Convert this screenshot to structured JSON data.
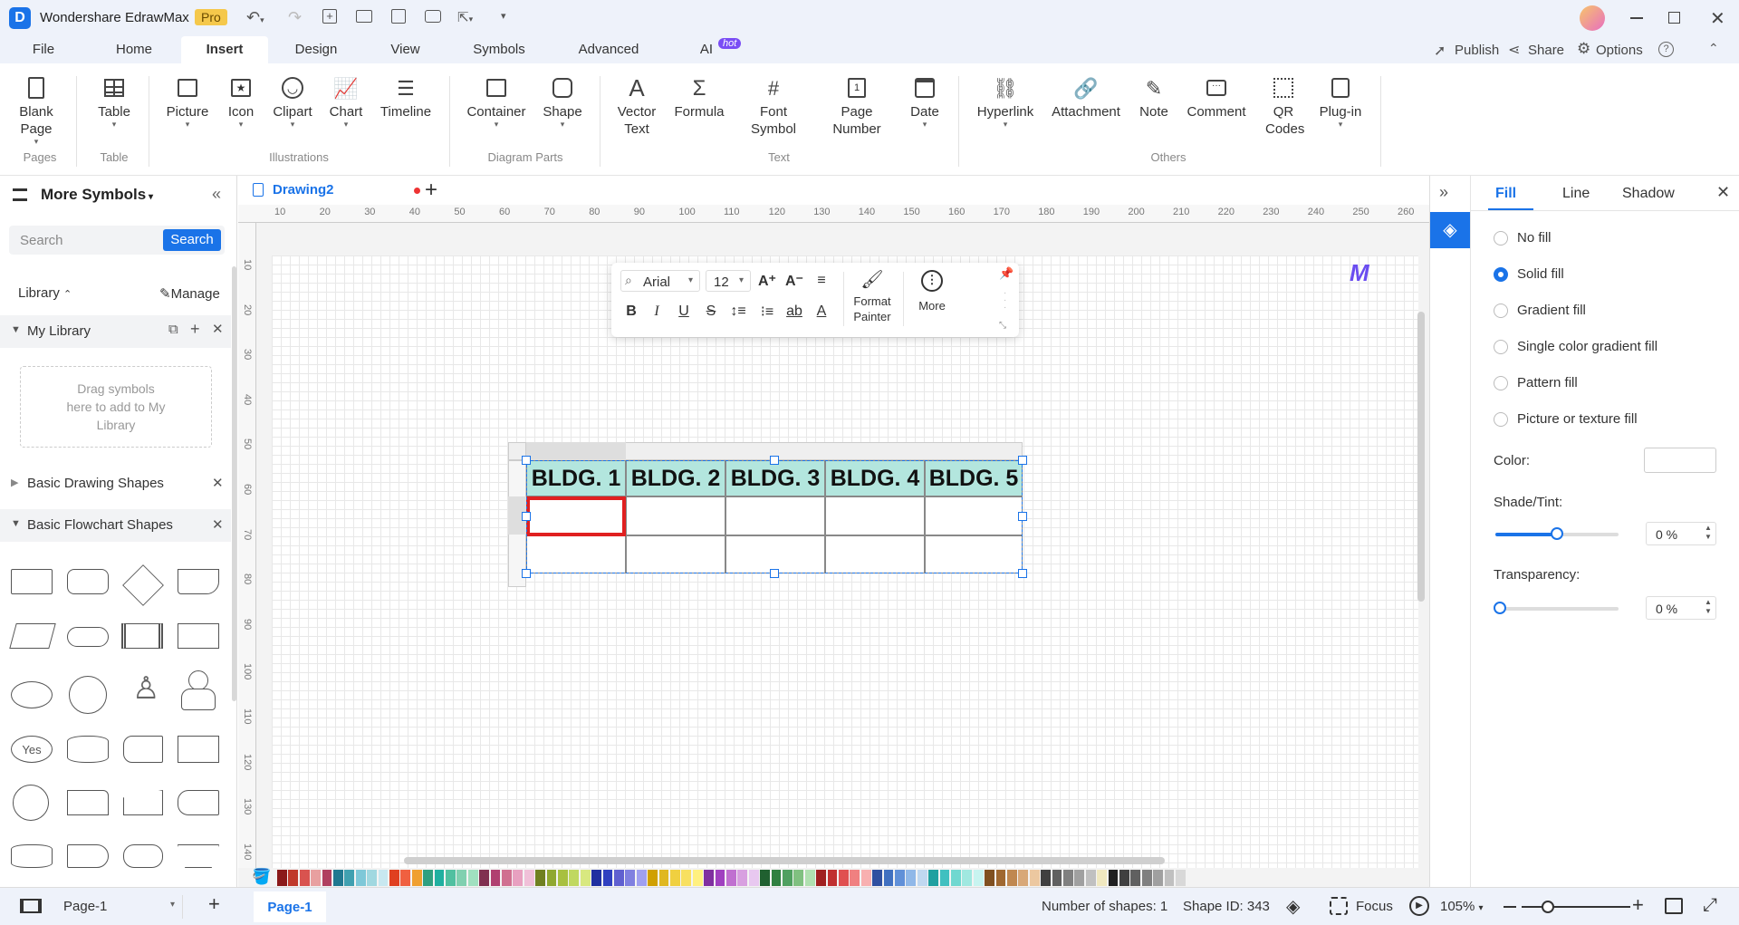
{
  "app": {
    "title": "Wondershare EdrawMax",
    "badge": "Pro"
  },
  "menu": {
    "tabs": [
      "File",
      "Home",
      "Insert",
      "Design",
      "View",
      "Symbols",
      "Advanced",
      "AI"
    ],
    "ai_badge": "hot",
    "active": "Insert",
    "right": {
      "publish": "Publish",
      "share": "Share",
      "options": "Options"
    }
  },
  "ribbon": {
    "buttons": [
      {
        "label": "Blank Page",
        "icon": "blank-page-icon"
      },
      {
        "label": "Table",
        "icon": "table-icon"
      },
      {
        "label": "Picture",
        "icon": "picture-icon"
      },
      {
        "label": "Icon",
        "icon": "icon-icon"
      },
      {
        "label": "Clipart",
        "icon": "clipart-icon"
      },
      {
        "label": "Chart",
        "icon": "chart-icon"
      },
      {
        "label": "Timeline",
        "icon": "timeline-icon"
      },
      {
        "label": "Container",
        "icon": "container-icon"
      },
      {
        "label": "Shape",
        "icon": "shape-icon"
      },
      {
        "label": "Vector Text",
        "icon": "vector-text-icon"
      },
      {
        "label": "Formula",
        "icon": "formula-icon"
      },
      {
        "label": "Font Symbol",
        "icon": "font-symbol-icon"
      },
      {
        "label": "Page Number",
        "icon": "page-number-icon"
      },
      {
        "label": "Date",
        "icon": "date-icon"
      },
      {
        "label": "Hyperlink",
        "icon": "hyperlink-icon"
      },
      {
        "label": "Attachment",
        "icon": "attachment-icon"
      },
      {
        "label": "Note",
        "icon": "note-icon"
      },
      {
        "label": "Comment",
        "icon": "comment-icon"
      },
      {
        "label": "QR Codes",
        "icon": "qr-codes-icon"
      },
      {
        "label": "Plug-in",
        "icon": "plug-in-icon"
      }
    ],
    "groups": [
      "Pages",
      "Table",
      "Illustrations",
      "Diagram Parts",
      "Text",
      "Others"
    ]
  },
  "left_panel": {
    "title": "More Symbols",
    "search_placeholder": "Search",
    "search_button": "Search",
    "library_label": "Library",
    "manage_label": "Manage",
    "my_library": "My Library",
    "drop_hint": "Drag symbols here to add to My Library",
    "sections": [
      "Basic Drawing Shapes",
      "Basic Flowchart Shapes"
    ],
    "yes_shape_label": "Yes"
  },
  "document": {
    "tab_name": "Drawing2",
    "ruler_top": [
      "10",
      "20",
      "30",
      "40",
      "50",
      "60",
      "70",
      "80",
      "90",
      "100",
      "110",
      "120",
      "130",
      "140",
      "150",
      "160",
      "170",
      "180",
      "190",
      "200",
      "210",
      "220",
      "230",
      "240",
      "250",
      "260"
    ],
    "ruler_left": [
      "10",
      "20",
      "30",
      "40",
      "50",
      "60",
      "70",
      "80",
      "90",
      "100",
      "110",
      "120",
      "130",
      "140"
    ]
  },
  "floating_toolbar": {
    "font": "Arial",
    "size": "12",
    "format_painter": "Format Painter",
    "more": "More"
  },
  "table": {
    "headers": [
      "BLDG. 1",
      "BLDG. 2",
      "BLDG. 3",
      "BLDG. 4",
      "BLDG. 5"
    ],
    "header_color": "#b3e6de",
    "selected_cell_color": "#e02020"
  },
  "right_panel": {
    "tabs": [
      "Fill",
      "Line",
      "Shadow"
    ],
    "active_tab": "Fill",
    "fill_options": [
      "No fill",
      "Solid fill",
      "Gradient fill",
      "Single color gradient fill",
      "Pattern fill",
      "Picture or texture fill"
    ],
    "selected_fill": "Solid fill",
    "color_label": "Color:",
    "shade_label": "Shade/Tint:",
    "shade_value": "0 %",
    "shade_level": 0.5,
    "transparency_label": "Transparency:",
    "transparency_value": "0 %",
    "transparency_level": 0
  },
  "status": {
    "page_select": "Page-1",
    "page_tab": "Page-1",
    "shapes_count": "Number of shapes: 1",
    "shape_id": "Shape ID: 343",
    "focus": "Focus",
    "zoom": "105%"
  },
  "palette": [
    "#8b1a1a",
    "#c0392b",
    "#d9534f",
    "#e8a0a0",
    "#b04060",
    "#207890",
    "#40a0b0",
    "#7ec8d8",
    "#a0d8e0",
    "#c8e8f0",
    "#e04020",
    "#f06040",
    "#f0a030",
    "#30a080",
    "#20b0a0",
    "#50c0a0",
    "#80d0b0",
    "#a0e0c0",
    "#803050",
    "#b04070",
    "#d07090",
    "#e8a0c0",
    "#f0c0d8",
    "#708020",
    "#90a830",
    "#a8c040",
    "#c0d860",
    "#d8e880",
    "#2030a0",
    "#3040c0",
    "#6060d0",
    "#8080e0",
    "#a0a0f0",
    "#d0a000",
    "#e0b820",
    "#f0d040",
    "#f8e060",
    "#fff080",
    "#8030a0",
    "#a040c0",
    "#c070d0",
    "#d8a0e0",
    "#e8c8f0",
    "#206030",
    "#308040",
    "#50a060",
    "#80c080",
    "#b0e0b0",
    "#a02020",
    "#c03030",
    "#e05050",
    "#f08080",
    "#f8b0b0",
    "#3050a0",
    "#4070c0",
    "#6090d8",
    "#90b8e8",
    "#c0d8f0",
    "#20a0a0",
    "#40c0c0",
    "#70d8d0",
    "#a0e8e0",
    "#c8f4f0",
    "#805020",
    "#a06830",
    "#c08850",
    "#d8a878",
    "#ecc8a0",
    "#404040",
    "#606060",
    "#808080",
    "#a0a0a0",
    "#c0c0c0",
    "#f0e8c0",
    "#202020",
    "#404040",
    "#606060",
    "#808080",
    "#a0a0a0",
    "#c0c0c0",
    "#d8d8d8"
  ]
}
